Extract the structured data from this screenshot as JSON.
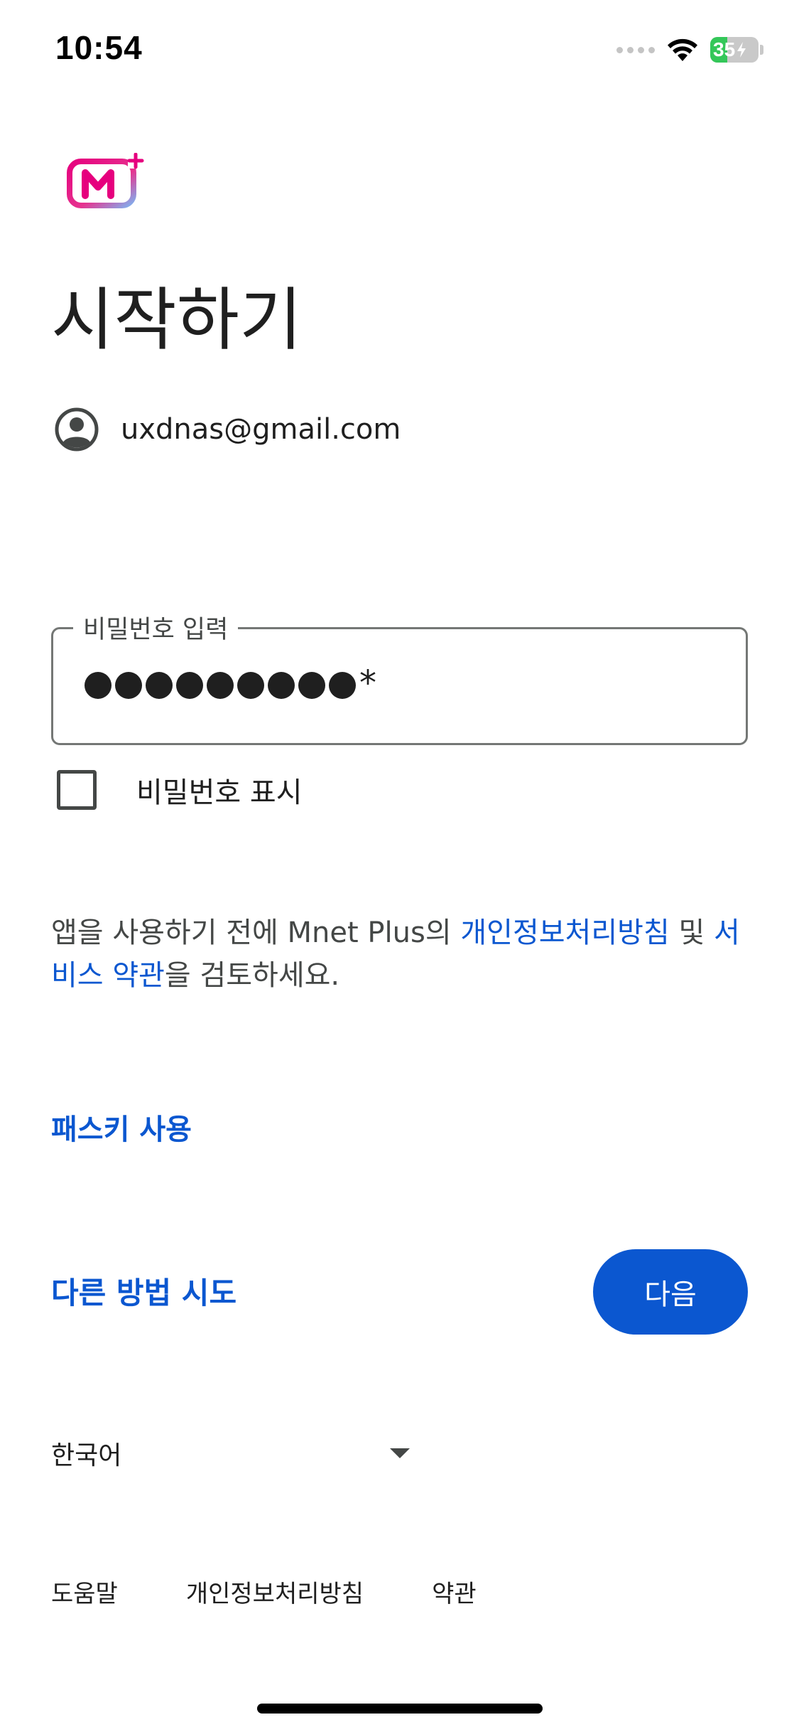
{
  "status_bar": {
    "time": "10:54",
    "battery": "35",
    "battery_level": 0.35
  },
  "brand": {
    "logo_icon": "mnet-plus-logo-icon",
    "accent": "#0b57d0"
  },
  "title": "시작하기",
  "account": {
    "icon": "account-circle-icon",
    "email": "uxdnas@gmail.com"
  },
  "password": {
    "label": "비밀번호 입력",
    "masked_dots": 9,
    "last_char": "*"
  },
  "show_password": {
    "label": "비밀번호 표시",
    "checked": false
  },
  "notice": {
    "prefix": "앱을 사용하기 전에 Mnet Plus의 ",
    "privacy_link": "개인정보처리방침",
    "middle": " 및 ",
    "terms_link": "서비스 약관",
    "suffix": "을 검토하세요."
  },
  "passkey_label": "패스키 사용",
  "other_method_label": "다른 방법 시도",
  "next_label": "다음",
  "language": {
    "selected": "한국어"
  },
  "footer": {
    "help": "도움말",
    "privacy": "개인정보처리방침",
    "terms": "약관"
  }
}
